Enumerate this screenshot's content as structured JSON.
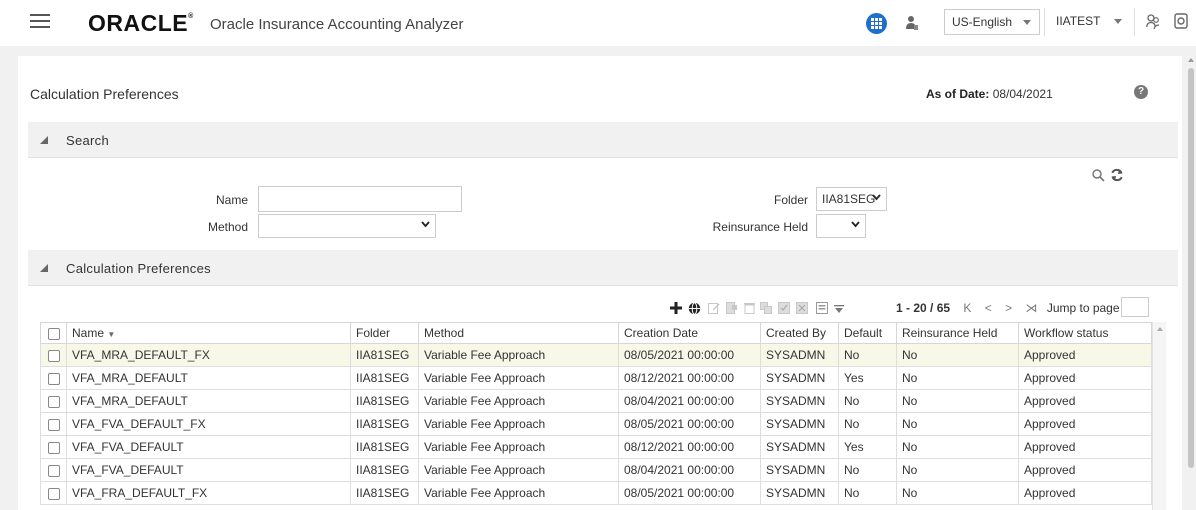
{
  "header": {
    "logo": "ORACLE",
    "logo_mark": "®",
    "app_name": "Oracle Insurance Accounting Analyzer",
    "language": "US-English",
    "user": "IIATEST"
  },
  "page": {
    "title": "Calculation Preferences",
    "as_of_label": "As of Date",
    "as_of_sep": ":",
    "as_of_value": "08/04/2021",
    "help_glyph": "?"
  },
  "search": {
    "section_label": "Search",
    "name_label": "Name",
    "name_value": "",
    "method_label": "Method",
    "method_value": "",
    "folder_label": "Folder",
    "folder_value": "IIA81SEG",
    "reinsurance_label": "Reinsurance Held",
    "reinsurance_value": ""
  },
  "results": {
    "section_label": "Calculation Preferences",
    "pager": {
      "range": "1 - 20 / 65",
      "first": "K",
      "prev": "<",
      "next": ">",
      "last": "⋊",
      "jump_label": "Jump to page"
    },
    "columns": [
      "Name",
      "Folder",
      "Method",
      "Creation Date",
      "Created By",
      "Default",
      "Reinsurance Held",
      "Workflow status"
    ],
    "sort_glyph": "▼",
    "rows": [
      {
        "name": "VFA_MRA_DEFAULT_FX",
        "folder": "IIA81SEG",
        "method": "Variable Fee Approach",
        "created": "08/05/2021 00:00:00",
        "by": "SYSADMN",
        "default": "No",
        "reins": "No",
        "status": "Approved"
      },
      {
        "name": "VFA_MRA_DEFAULT",
        "folder": "IIA81SEG",
        "method": "Variable Fee Approach",
        "created": "08/12/2021 00:00:00",
        "by": "SYSADMN",
        "default": "Yes",
        "reins": "No",
        "status": "Approved"
      },
      {
        "name": "VFA_MRA_DEFAULT",
        "folder": "IIA81SEG",
        "method": "Variable Fee Approach",
        "created": "08/04/2021 00:00:00",
        "by": "SYSADMN",
        "default": "No",
        "reins": "No",
        "status": "Approved"
      },
      {
        "name": "VFA_FVA_DEFAULT_FX",
        "folder": "IIA81SEG",
        "method": "Variable Fee Approach",
        "created": "08/05/2021 00:00:00",
        "by": "SYSADMN",
        "default": "No",
        "reins": "No",
        "status": "Approved"
      },
      {
        "name": "VFA_FVA_DEFAULT",
        "folder": "IIA81SEG",
        "method": "Variable Fee Approach",
        "created": "08/12/2021 00:00:00",
        "by": "SYSADMN",
        "default": "Yes",
        "reins": "No",
        "status": "Approved"
      },
      {
        "name": "VFA_FVA_DEFAULT",
        "folder": "IIA81SEG",
        "method": "Variable Fee Approach",
        "created": "08/04/2021 00:00:00",
        "by": "SYSADMN",
        "default": "No",
        "reins": "No",
        "status": "Approved"
      },
      {
        "name": "VFA_FRA_DEFAULT_FX",
        "folder": "IIA81SEG",
        "method": "Variable Fee Approach",
        "created": "08/05/2021 00:00:00",
        "by": "SYSADMN",
        "default": "No",
        "reins": "No",
        "status": "Approved"
      }
    ]
  },
  "icons": {
    "menu": "hamburger-icon",
    "apps": "app-grid-icon",
    "user": "user-icon",
    "people": "people-icon",
    "settings": "settings-icon",
    "search": "magnifier-icon",
    "reset": "refresh-icon",
    "add": "plus-icon",
    "view": "globe-icon"
  },
  "colors": {
    "brand_blue": "#1f6fcd",
    "section_bg": "#f1f1f1",
    "selected_row": "#f7f8e7"
  }
}
